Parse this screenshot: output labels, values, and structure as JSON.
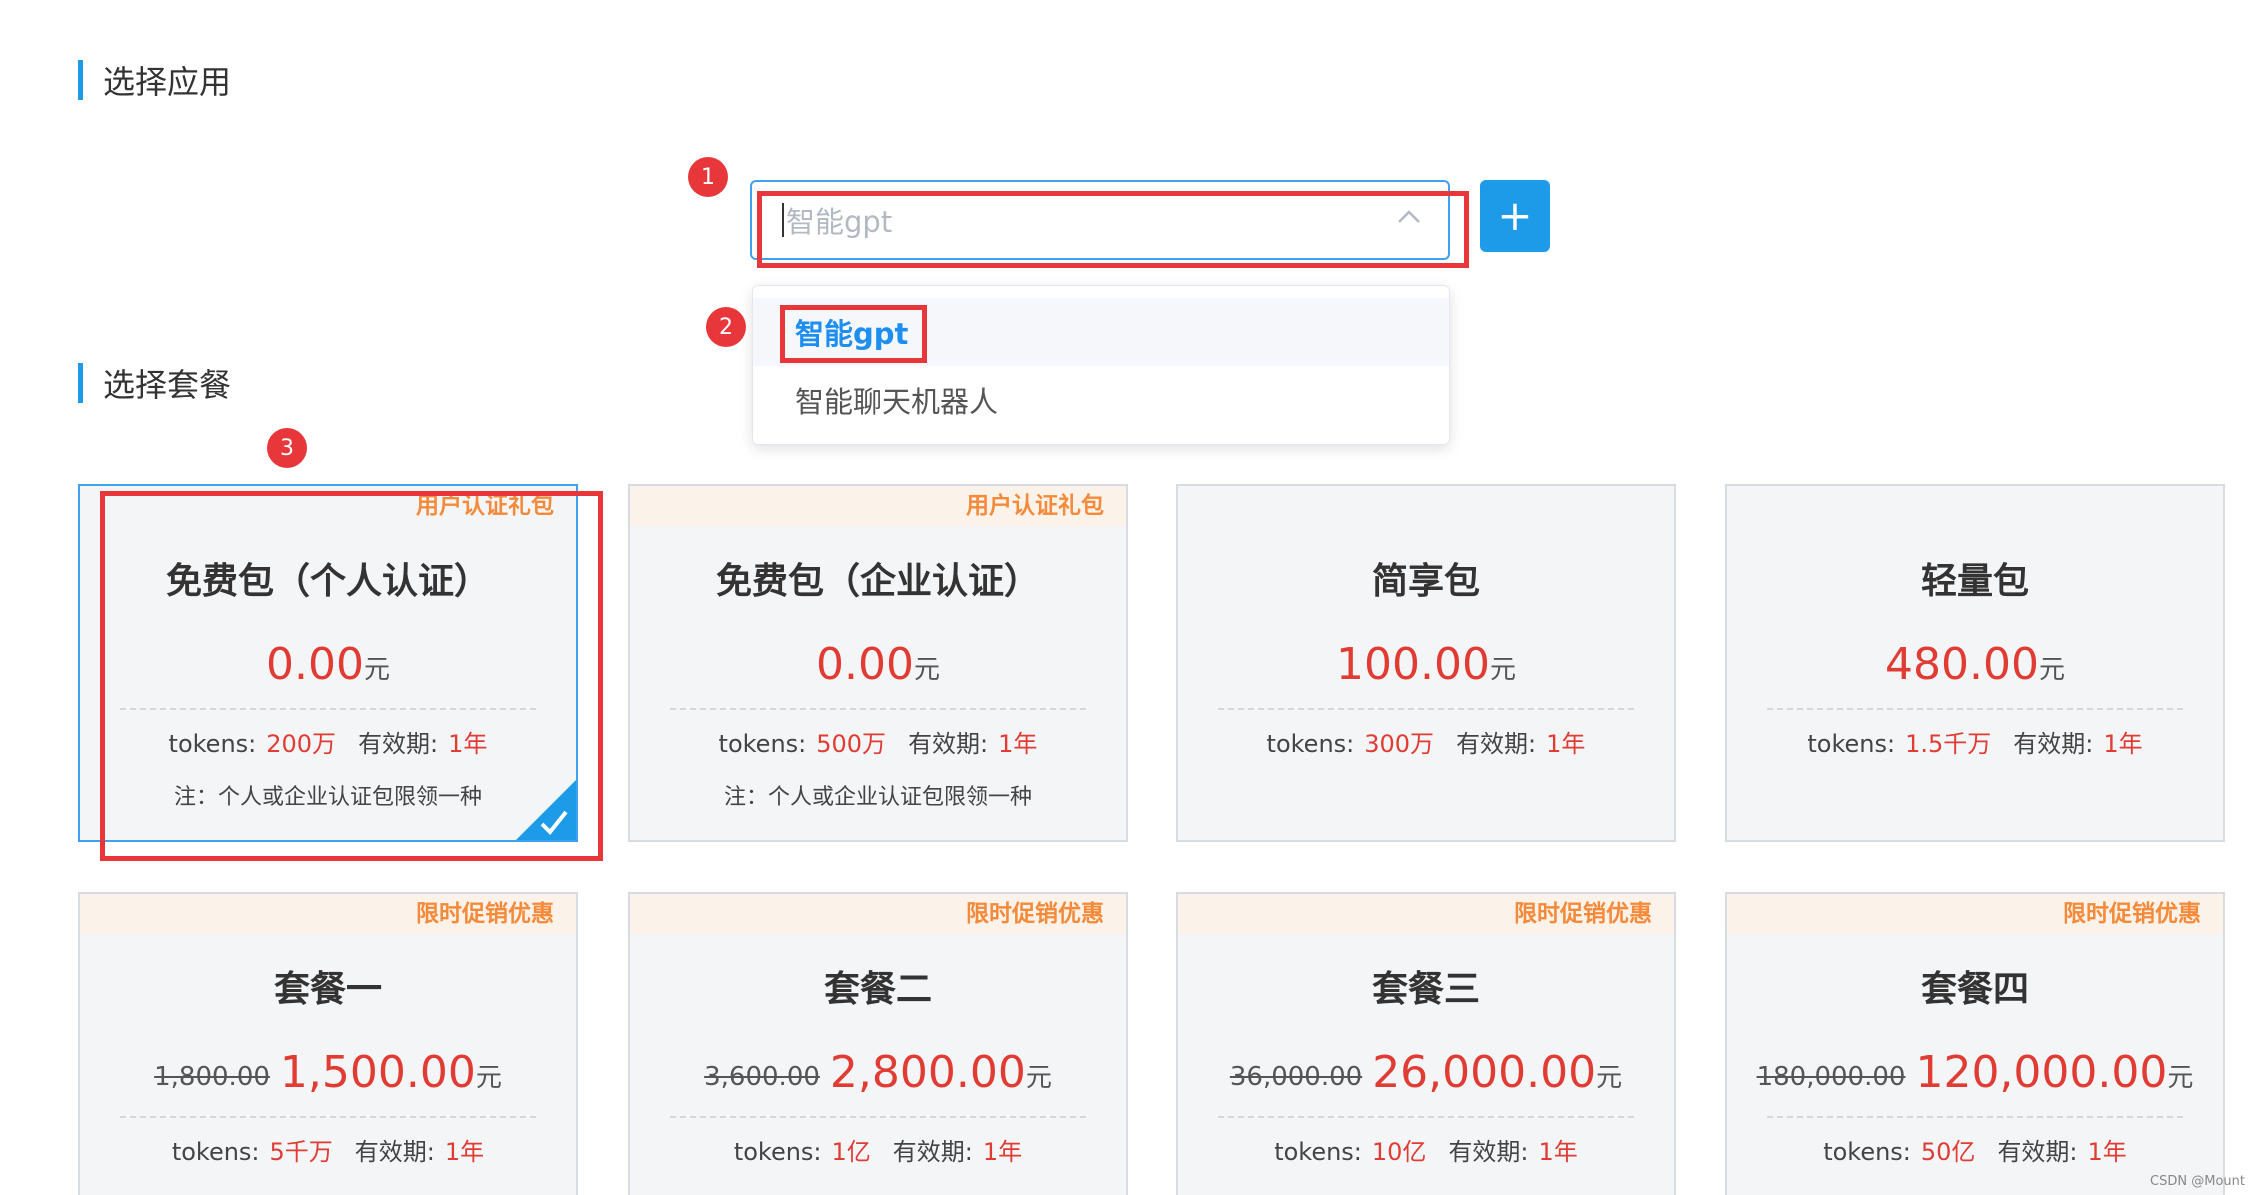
{
  "sections": {
    "app_title": "选择应用",
    "package_title": "选择套餐"
  },
  "app_select": {
    "placeholder": "智能gpt",
    "add_button": "+",
    "options": [
      {
        "label": "智能gpt",
        "selected": true
      },
      {
        "label": "智能聊天机器人",
        "selected": false
      }
    ]
  },
  "annotations": [
    "1",
    "2",
    "3"
  ],
  "labels": {
    "tokens": "tokens:",
    "validity": "有效期:"
  },
  "packages_row1": [
    {
      "tag": "用户认证礼包",
      "name": "免费包（个人认证）",
      "price": "0.00",
      "unit": "元",
      "tokens": "200万",
      "validity": "1年",
      "note": "注：个人或企业认证包限领一种",
      "active": true
    },
    {
      "tag": "用户认证礼包",
      "name": "免费包（企业认证）",
      "price": "0.00",
      "unit": "元",
      "tokens": "500万",
      "validity": "1年",
      "note": "注：个人或企业认证包限领一种",
      "active": false
    },
    {
      "tag": "",
      "name": "简享包",
      "price": "100.00",
      "unit": "元",
      "tokens": "300万",
      "validity": "1年",
      "note": "",
      "active": false
    },
    {
      "tag": "",
      "name": "轻量包",
      "price": "480.00",
      "unit": "元",
      "tokens": "1.5千万",
      "validity": "1年",
      "note": "",
      "active": false
    }
  ],
  "packages_row2": [
    {
      "tag": "限时促销优惠",
      "name": "套餐一",
      "old_price": "1,800.00",
      "price": "1,500.00",
      "unit": "元",
      "tokens": "5千万",
      "validity": "1年"
    },
    {
      "tag": "限时促销优惠",
      "name": "套餐二",
      "old_price": "3,600.00",
      "price": "2,800.00",
      "unit": "元",
      "tokens": "1亿",
      "validity": "1年"
    },
    {
      "tag": "限时促销优惠",
      "name": "套餐三",
      "old_price": "36,000.00",
      "price": "26,000.00",
      "unit": "元",
      "tokens": "10亿",
      "validity": "1年"
    },
    {
      "tag": "限时促销优惠",
      "name": "套餐四",
      "old_price": "180,000.00",
      "price": "120,000.00",
      "unit": "元",
      "tokens": "50亿",
      "validity": "1年"
    }
  ],
  "watermark": "CSDN @Mount",
  "colors": {
    "accent": "#1e9be8",
    "price": "#e03c34",
    "tag": "#f48a3a",
    "annotation": "#e8373a"
  }
}
